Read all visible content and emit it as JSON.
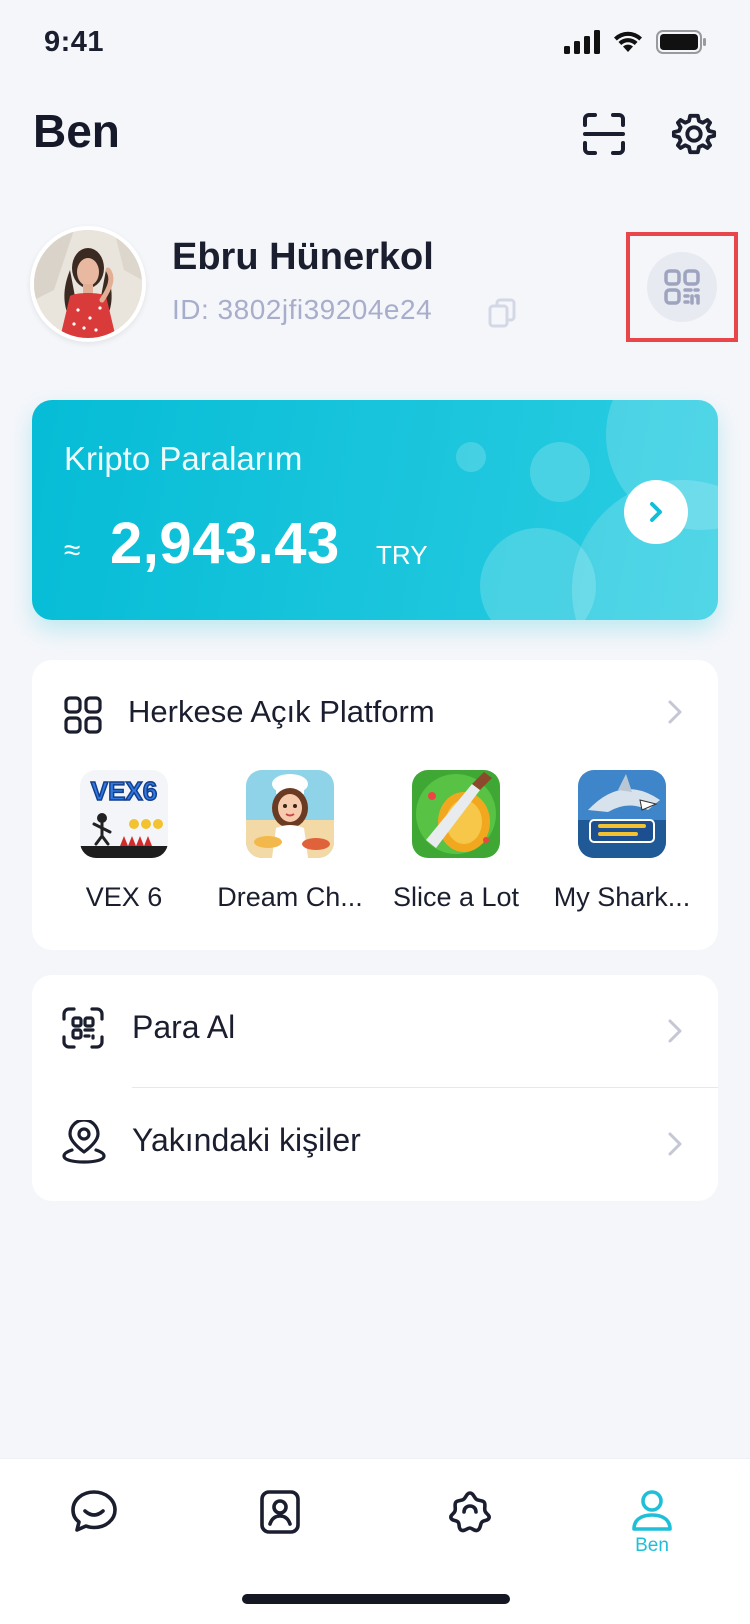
{
  "status_bar": {
    "time": "9:41"
  },
  "header": {
    "title": "Ben"
  },
  "profile": {
    "name": "Ebru Hünerkol",
    "id_text": "ID: 3802jfi39204e24"
  },
  "crypto": {
    "label": "Kripto Paralarım",
    "approx": "≈",
    "amount": "2,943.43",
    "currency": "TRY"
  },
  "platform": {
    "title": "Herkese Açık Platform",
    "apps": [
      {
        "name": "VEX 6",
        "icon": "vex6-game-icon"
      },
      {
        "name": "Dream Ch...",
        "icon": "dream-chef-game-icon"
      },
      {
        "name": "Slice a Lot",
        "icon": "slice-a-lot-game-icon"
      },
      {
        "name": "My Shark...",
        "icon": "my-shark-show-game-icon"
      }
    ]
  },
  "menu": [
    {
      "label": "Para Al",
      "icon": "receive-money-qr-icon"
    },
    {
      "label": "Yakındaki kişiler",
      "icon": "nearby-people-icon"
    }
  ],
  "tabs": [
    {
      "label": "",
      "icon": "chat-icon",
      "active": false
    },
    {
      "label": "",
      "icon": "contacts-icon",
      "active": false
    },
    {
      "label": "",
      "icon": "discover-icon",
      "active": false
    },
    {
      "label": "Ben",
      "icon": "profile-icon",
      "active": true
    }
  ],
  "colors": {
    "accent": "#1FBFD8",
    "card_gradient_start": "#06BCD6",
    "highlight_border": "#E8464B",
    "background": "#F4F6FA"
  },
  "app_icon_text": {
    "vex": "VEX6"
  }
}
